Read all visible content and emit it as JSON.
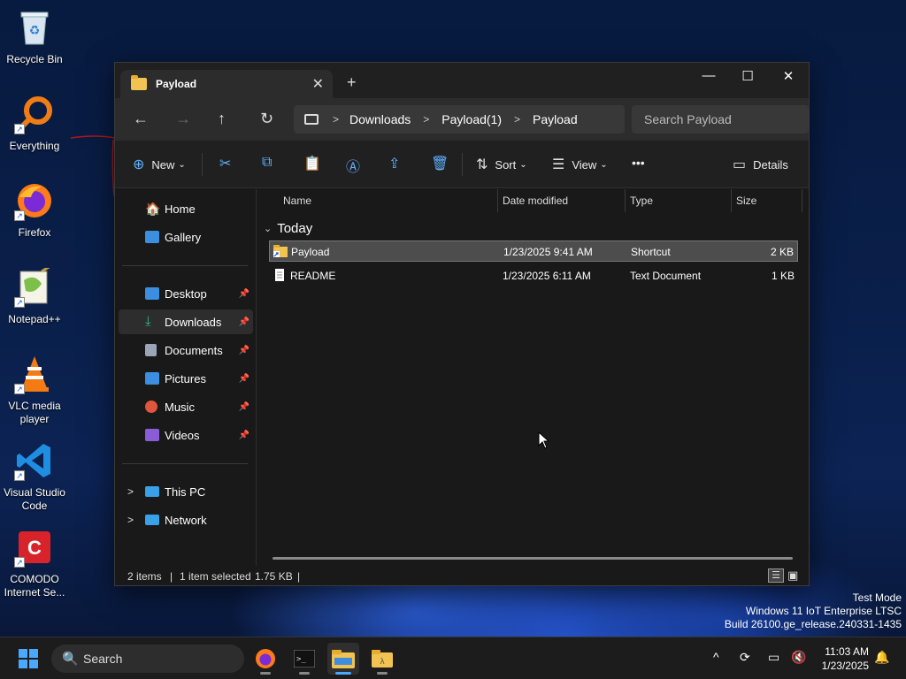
{
  "desktop": {
    "icons": [
      {
        "label": "Recycle Bin",
        "icon": "recycle-bin-icon"
      },
      {
        "label": "Everything",
        "icon": "everything-search-icon"
      },
      {
        "label": "Firefox",
        "icon": "firefox-icon"
      },
      {
        "label": "Notepad++",
        "icon": "notepad-plus-plus-icon"
      },
      {
        "label": "VLC media player",
        "icon": "vlc-icon"
      },
      {
        "label": "Visual Studio Code",
        "icon": "vscode-icon"
      },
      {
        "label": "COMODO Internet Se...",
        "icon": "comodo-icon"
      }
    ],
    "watermark": [
      "Test Mode",
      "Windows 11 IoT Enterprise LTSC",
      "Build 26100.ge_release.240331-1435"
    ]
  },
  "window": {
    "tab_title": "Payload",
    "tab_close": "✕",
    "new_tab": "+",
    "controls": {
      "minimize": "—",
      "maximize": "☐",
      "close": "✕"
    },
    "nav": {
      "back": "←",
      "forward": "→",
      "up": "↑",
      "refresh": "↻"
    },
    "breadcrumb": [
      "Downloads",
      "Payload(1)",
      "Payload"
    ],
    "breadcrumb_sep": ">",
    "search_placeholder": "Search Payload",
    "toolbar": {
      "new_label": "New",
      "sort_label": "Sort",
      "view_label": "View",
      "more_label": "•••",
      "details_label": "Details",
      "dropdown_caret": "⌄"
    },
    "sidebar": {
      "home": "Home",
      "gallery": "Gallery",
      "quick_access": [
        {
          "label": "Desktop",
          "color": "#3c8ee0"
        },
        {
          "label": "Downloads",
          "color": "#2fb98a"
        },
        {
          "label": "Documents",
          "color": "#9aa6b8"
        },
        {
          "label": "Pictures",
          "color": "#3c8ee0"
        },
        {
          "label": "Music",
          "color": "#e0563c"
        },
        {
          "label": "Videos",
          "color": "#8a5cd8"
        }
      ],
      "pin_glyph": "📌",
      "this_pc": "This PC",
      "network": "Network",
      "expand_glyph": ">"
    },
    "columns": {
      "name": "Name",
      "date": "Date modified",
      "type": "Type",
      "size": "Size"
    },
    "group": {
      "label": "Today",
      "chevron": "⌄"
    },
    "files": [
      {
        "name": "Payload",
        "date": "1/23/2025 9:41 AM",
        "type": "Shortcut",
        "size": "2 KB",
        "selected": true
      },
      {
        "name": "README",
        "date": "1/23/2025 6:11 AM",
        "type": "Text Document",
        "size": "1 KB",
        "selected": false
      }
    ],
    "status": {
      "items": "2 items",
      "selected": "1 item selected",
      "size": "1.75 KB",
      "sep": "|"
    }
  },
  "taskbar": {
    "search_label": "Search",
    "search_icon": "🔍",
    "tray_chevron": "^",
    "clock_time": "11:03 AM",
    "clock_date": "1/23/2025",
    "bell": "🔔"
  },
  "colors": {
    "accent": "#4aa8ff",
    "selection": "#4d4d4d",
    "folder": "#f2c350"
  }
}
